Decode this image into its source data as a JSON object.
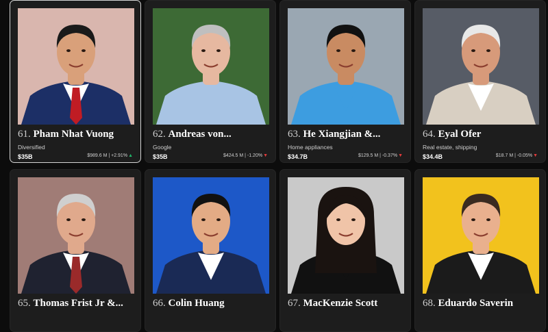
{
  "cards": [
    {
      "rank": "61.",
      "name": "Pham Nhat Vuong",
      "industry": "Diversified",
      "net_worth": "$35B",
      "change": "$989.6 M | +2.91%",
      "direction": "up",
      "arrow": "▲",
      "photo": {
        "bg": "#d9b6ae",
        "skin": "#d9a07a",
        "hair": "#1a1a1a",
        "suit": "#1c2f66",
        "shirt": "#ffffff",
        "tie": "#c01c24"
      }
    },
    {
      "rank": "62.",
      "name": "Andreas von...",
      "industry": "Google",
      "net_worth": "$35B",
      "change": "$424.5 M | -1.20%",
      "direction": "down",
      "arrow": "▼",
      "photo": {
        "bg": "#3d6a35",
        "skin": "#e6b8a0",
        "hair": "#bfbfbf",
        "suit": "#a8c4e4",
        "shirt": "#a8c4e4",
        "tie": ""
      }
    },
    {
      "rank": "63.",
      "name": "He Xiangjian &...",
      "industry": "Home appliances",
      "net_worth": "$34.7B",
      "change": "$129.5 M | -0.37%",
      "direction": "down",
      "arrow": "▼",
      "photo": {
        "bg": "#9aa7b2",
        "skin": "#c98b62",
        "hair": "#111111",
        "suit": "#3d9de0",
        "shirt": "#3d9de0",
        "tie": ""
      }
    },
    {
      "rank": "64.",
      "name": "Eyal Ofer",
      "industry": "Real estate, shipping",
      "net_worth": "$34.4B",
      "change": "$18.7 M | -0.05%",
      "direction": "down",
      "arrow": "▼",
      "photo": {
        "bg": "#575c66",
        "skin": "#d79a7a",
        "hair": "#e8e8e8",
        "suit": "#d8cfc2",
        "shirt": "#ffffff",
        "tie": ""
      }
    },
    {
      "rank": "65.",
      "name": "Thomas Frist Jr &...",
      "industry": "",
      "net_worth": "",
      "change": "",
      "direction": "",
      "arrow": "",
      "photo": {
        "bg": "#a07c76",
        "skin": "#e0a98c",
        "hair": "#cfcfcf",
        "suit": "#1f2230",
        "shirt": "#ffffff",
        "tie": "#9a2a2a"
      }
    },
    {
      "rank": "66.",
      "name": "Colin Huang",
      "industry": "",
      "net_worth": "",
      "change": "",
      "direction": "",
      "arrow": "",
      "photo": {
        "bg": "#1d58c8",
        "skin": "#e3ab85",
        "hair": "#111111",
        "suit": "#1a2a55",
        "shirt": "#ffffff",
        "tie": ""
      }
    },
    {
      "rank": "67.",
      "name": "MacKenzie Scott",
      "industry": "",
      "net_worth": "",
      "change": "",
      "direction": "",
      "arrow": "",
      "photo": {
        "bg": "#c9c9c9",
        "skin": "#f0c4a8",
        "hair": "#1a1310",
        "suit": "#111111",
        "shirt": "#111111",
        "tie": ""
      }
    },
    {
      "rank": "68.",
      "name": "Eduardo Saverin",
      "industry": "",
      "net_worth": "",
      "change": "",
      "direction": "",
      "arrow": "",
      "photo": {
        "bg": "#f2c21d",
        "skin": "#e9b08e",
        "hair": "#3a2a20",
        "suit": "#1b1b1b",
        "shirt": "#ffffff",
        "tie": ""
      }
    }
  ]
}
